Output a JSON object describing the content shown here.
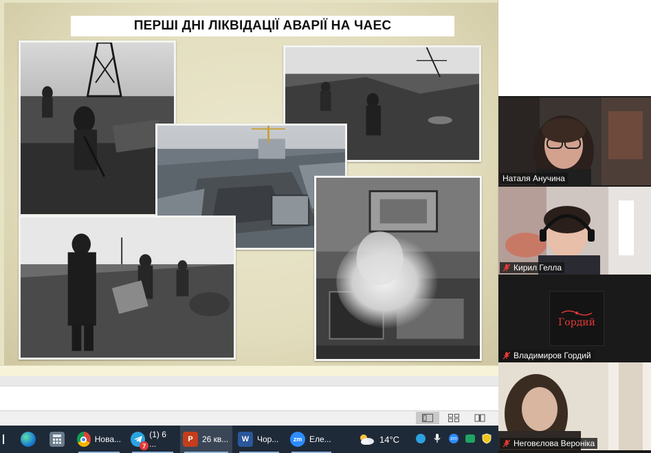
{
  "slide": {
    "title": "ПЕРШІ ДНІ ЛІКВІДАЦІЇ АВАРІЇ НА ЧАЕС",
    "photos": [
      {
        "name": "liquidators-on-roof-photo",
        "tone": "bw"
      },
      {
        "name": "roof-debris-photo",
        "tone": "bw"
      },
      {
        "name": "destroyed-reactor-color-photo",
        "tone": "color"
      },
      {
        "name": "workers-with-debris-photo",
        "tone": "bw"
      },
      {
        "name": "aerial-reactor-smoke-photo",
        "tone": "bw"
      }
    ]
  },
  "status_bar": {
    "views": [
      "normal-view-icon",
      "slide-sorter-icon",
      "reading-view-icon"
    ]
  },
  "zoom": {
    "participants": [
      {
        "name": "Наталя Анучина",
        "muted": false,
        "active_speaker": true,
        "video": true
      },
      {
        "name": "Кирил Гелла",
        "muted": true,
        "active_speaker": false,
        "video": true
      },
      {
        "name": "Владимиров Гордий",
        "muted": true,
        "active_speaker": false,
        "video": false,
        "avatar_text": "Гордий"
      },
      {
        "name": "Неговєлова Вероніка",
        "muted": true,
        "active_speaker": false,
        "video": true
      }
    ]
  },
  "taskbar": {
    "items": [
      {
        "icon": "start-icon",
        "label": ""
      },
      {
        "icon": "edge-icon",
        "label": ""
      },
      {
        "icon": "calculator-icon",
        "label": ""
      },
      {
        "icon": "chrome-icon",
        "label": "Нова..."
      },
      {
        "icon": "telegram-icon",
        "label": "(1) 6 ...",
        "badge": "7"
      },
      {
        "icon": "powerpoint-icon",
        "label": "26 кв..."
      },
      {
        "icon": "word-icon",
        "label": "Чор..."
      },
      {
        "icon": "zoom-icon",
        "label": "Еле..."
      }
    ],
    "weather": "14°C"
  },
  "colors": {
    "taskbar_bg": "#1f2a38",
    "active_speaker_border": "#b7e46a",
    "muted_red": "#e53935",
    "slide_paper": "#e6e3c4"
  }
}
